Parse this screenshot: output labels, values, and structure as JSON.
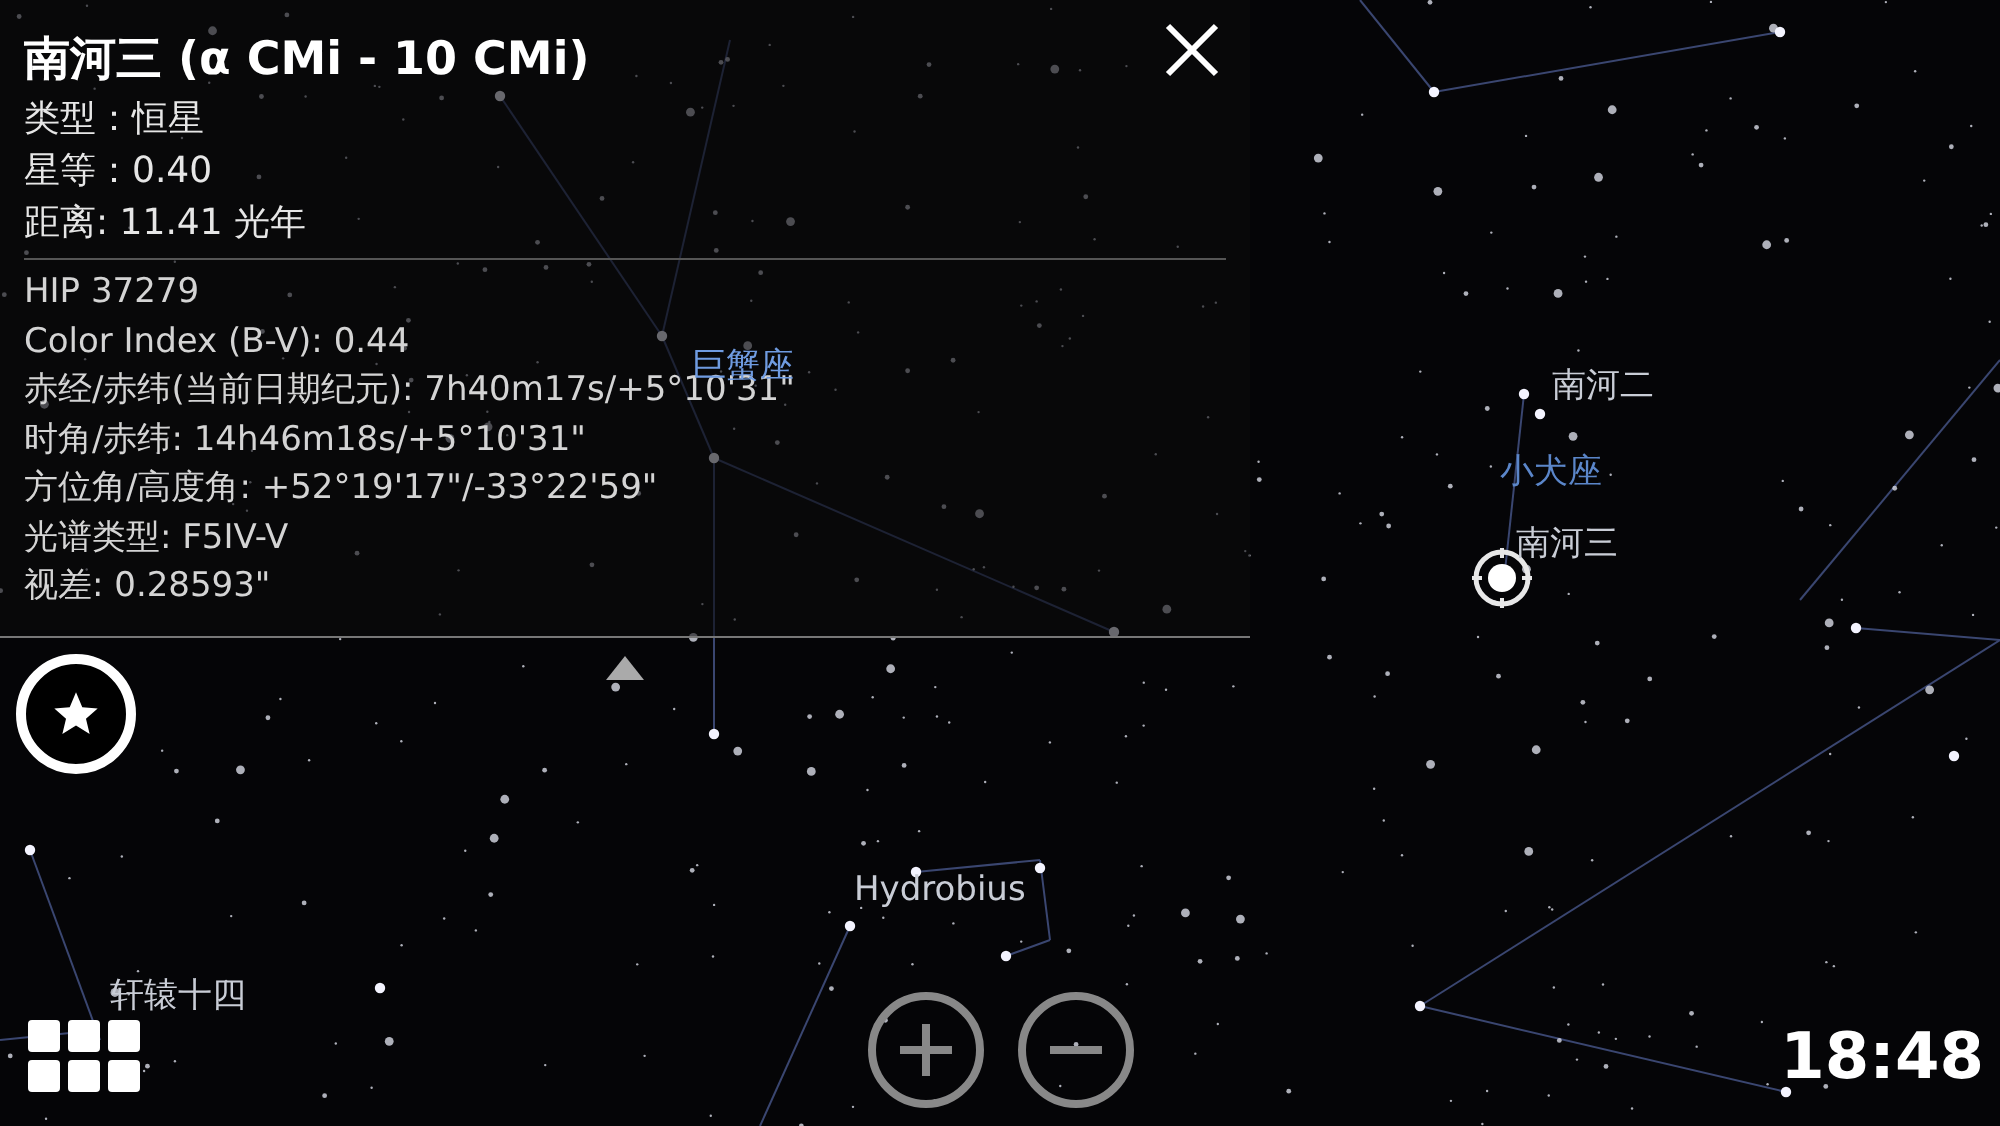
{
  "info_panel": {
    "title": "南河三 (α CMi - 10 CMi)",
    "summary": [
      "类型：恒星",
      "星等：0.40",
      "距离: 11.41 光年"
    ],
    "details": [
      "HIP 37279",
      "Color Index (B-V): 0.44",
      "赤经/赤纬(当前日期纪元):  7h40m17s/+5°10'31\"",
      "时角/赤纬: 14h46m18s/+5°10'31\"",
      "方位角/高度角: +52°19'17\"/-33°22'59\"",
      "光谱类型: F5IV-V",
      "视差: 0.28593\""
    ]
  },
  "sky_labels": [
    {
      "text": "巨蟹座",
      "kind": "constellation"
    },
    {
      "text": "南河二",
      "kind": "star"
    },
    {
      "text": "小犬座",
      "kind": "constellation"
    },
    {
      "text": "南河三",
      "kind": "star"
    },
    {
      "text": "Hydrobius",
      "kind": "star"
    },
    {
      "text": "轩辕十四",
      "kind": "star"
    }
  ],
  "clock": "18:48"
}
